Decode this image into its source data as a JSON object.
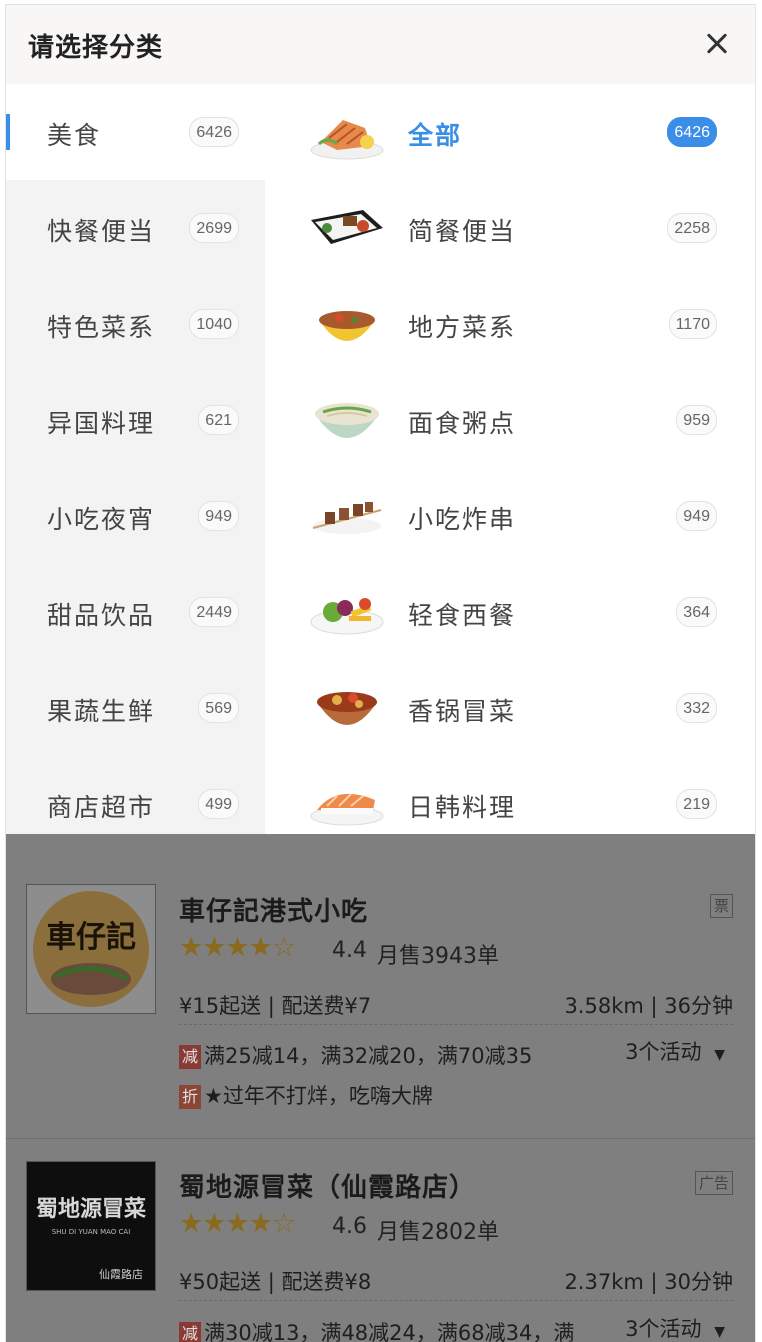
{
  "header": {
    "title": "请选择分类"
  },
  "left_categories": [
    {
      "label": "美食",
      "count": "6426",
      "active": true
    },
    {
      "label": "快餐便当",
      "count": "2699"
    },
    {
      "label": "特色菜系",
      "count": "1040"
    },
    {
      "label": "异国料理",
      "count": "621"
    },
    {
      "label": "小吃夜宵",
      "count": "949"
    },
    {
      "label": "甜品饮品",
      "count": "2449"
    },
    {
      "label": "果蔬生鲜",
      "count": "569"
    },
    {
      "label": "商店超市",
      "count": "499"
    }
  ],
  "sub_categories": [
    {
      "label": "全部",
      "count": "6426",
      "active": true,
      "icon": "grilled-salmon-plate-icon"
    },
    {
      "label": "简餐便当",
      "count": "2258",
      "icon": "bento-box-icon"
    },
    {
      "label": "地方菜系",
      "count": "1170",
      "icon": "bowl-dish-icon"
    },
    {
      "label": "面食粥点",
      "count": "959",
      "icon": "noodle-bowl-icon"
    },
    {
      "label": "小吃炸串",
      "count": "949",
      "icon": "skewers-icon"
    },
    {
      "label": "轻食西餐",
      "count": "364",
      "icon": "salad-plate-icon"
    },
    {
      "label": "香锅冒菜",
      "count": "332",
      "icon": "spicy-pot-icon"
    },
    {
      "label": "日韩料理",
      "count": "219",
      "icon": "sushi-icon"
    }
  ],
  "shops": [
    {
      "name": "車仔記港式小吃",
      "logo_text": "車仔記",
      "stars": "★★★★☆",
      "rating": "4.4",
      "sales": "月售3943单",
      "min_order": "¥15起送",
      "delivery_fee": "配送费¥7",
      "distance": "3.58km",
      "time": "36分钟",
      "tag": "票",
      "promos": [
        {
          "tag": "减",
          "text": "满25减14，满32减20，满70减35"
        },
        {
          "tag": "折",
          "text": "★过年不打烊，吃嗨大牌"
        }
      ],
      "activities": "3个活动"
    },
    {
      "name": "蜀地源冒菜（仙霞路店）",
      "logo_text": "蜀地源冒菜",
      "logo_sub": "SHU DI YUAN MAO CAI",
      "logo_branch": "仙霞路店",
      "stars": "★★★★☆",
      "rating": "4.6",
      "sales": "月售2802单",
      "min_order": "¥50起送",
      "delivery_fee": "配送费¥8",
      "distance": "2.37km",
      "time": "30分钟",
      "tag": "广告",
      "promos": [
        {
          "tag": "减",
          "text": "满30减13，满48减24，满68减34，满"
        }
      ],
      "activities": "3个活动"
    }
  ],
  "colors": {
    "accent": "#3b8ee8",
    "overlay": "#7f7f7f",
    "star": "#8a6a1f",
    "promo_reduce": "#8a3a35",
    "promo_discount": "#8a4535"
  }
}
